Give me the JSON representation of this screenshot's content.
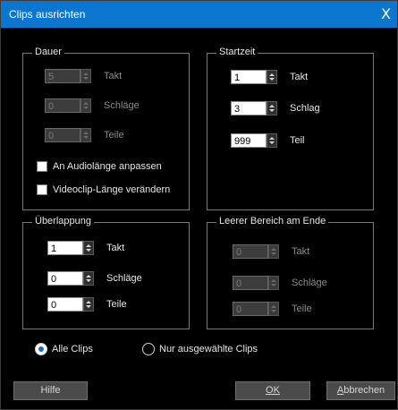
{
  "window": {
    "title": "Clips ausrichten",
    "close_glyph": "X"
  },
  "dauer": {
    "legend": "Dauer",
    "takt": {
      "value": "5",
      "label": "Takt"
    },
    "schlaege": {
      "value": "0",
      "label": "Schläge"
    },
    "teile": {
      "value": "0",
      "label": "Teile"
    },
    "audio_checkbox": "An Audiolänge anpassen",
    "video_checkbox": "Videoclip-Länge verändern"
  },
  "startzeit": {
    "legend": "Startzeit",
    "takt": {
      "value": "1",
      "label": "Takt"
    },
    "schlag": {
      "value": "3",
      "label": "Schlag"
    },
    "teil": {
      "value": "999",
      "label": "Teil"
    }
  },
  "ueberlappung": {
    "legend": "Überlappung",
    "takt": {
      "value": "1",
      "label": "Takt"
    },
    "schlaege": {
      "value": "0",
      "label": "Schläge"
    },
    "teile": {
      "value": "0",
      "label": "Teile"
    }
  },
  "leerer_bereich": {
    "legend": "Leerer Bereich am Ende",
    "takt": {
      "value": "0",
      "label": "Takt"
    },
    "schlaege": {
      "value": "0",
      "label": "Schläge"
    },
    "teile": {
      "value": "0",
      "label": "Teile"
    }
  },
  "scope": {
    "alle_clips": "Alle Clips",
    "nur_ausgewaehlte": "Nur ausgewählte Clips",
    "selected": "alle_clips"
  },
  "buttons": {
    "hilfe": "Hilfe",
    "ok": "OK",
    "abbrechen_first": "A",
    "abbrechen_rest": "bbrechen"
  },
  "colors": {
    "titlebar": "#0a76d0",
    "background": "#000000",
    "text": "#e6e6e6",
    "button": "#4b4b4b"
  }
}
